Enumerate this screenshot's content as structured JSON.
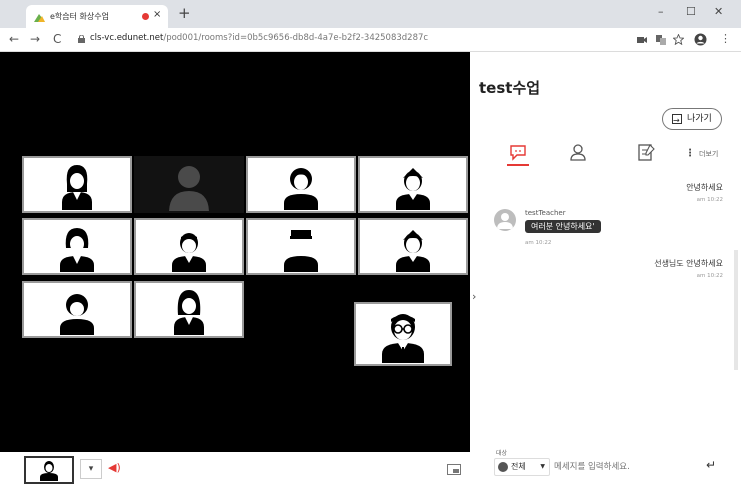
{
  "browser": {
    "tab_title": "e학습터 화상수업",
    "tab_close": "×",
    "new_tab": "+",
    "minimize": "–",
    "maximize": "☐",
    "close": "✕",
    "url_host": "cls-vc.edunet.net",
    "url_path": "/pod001/rooms?id=0b5c9656-db8d-4a7e-b2f2-3425083d287c",
    "back": "←",
    "forward": "→",
    "reload": "C",
    "menu": "⋮"
  },
  "panel": {
    "title": "test수업",
    "leave_label": "나가기",
    "more_label": "더보기",
    "collapse": "›",
    "messages": [
      {
        "text": "안녕하세요",
        "time": "am 10:22"
      },
      {
        "sender": "testTeacher",
        "text": "여러분 안녕하세요'",
        "time": "am 10:22"
      },
      {
        "text": "선생님도 안녕하세요",
        "time": "am 10:22"
      }
    ],
    "target_label": "대상",
    "target_value": "전체",
    "input_placeholder": "메세지를 입력하세요.",
    "send": "↵"
  },
  "bottombar": {
    "dropdown": "▾",
    "speaker": "◀)"
  },
  "colors": {
    "accent": "#e53935",
    "video_bg": "#000000",
    "tile_border": "#9a9a9a"
  }
}
